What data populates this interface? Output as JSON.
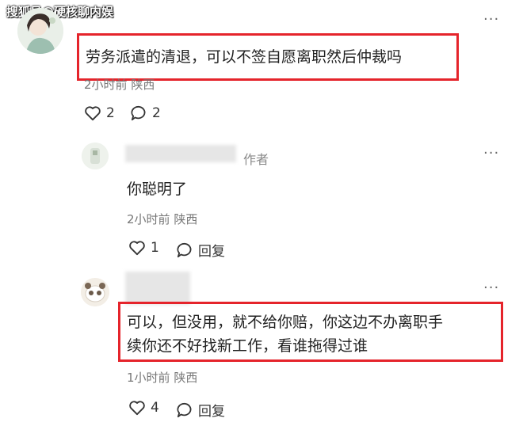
{
  "watermark": "搜狐号@硬核聊内娱",
  "more_label": "···",
  "top_comment": {
    "text": "劳务派遣的清退，可以不签自愿离职然后仲裁吗",
    "time": "2小时前",
    "location": "陕西",
    "like_count": "2",
    "reply_count": "2"
  },
  "reply1": {
    "author_tag": "作者",
    "text": "你聪明了",
    "time": "2小时前",
    "location": "陕西",
    "like_count": "1",
    "reply_label": "回复"
  },
  "reply2": {
    "text_line1": "可以，但没用，就不给你赔，你这边不办离职手",
    "text_line2": "续你还不好找新工作，看谁拖得过谁",
    "time": "1小时前",
    "location": "陕西",
    "like_count": "4",
    "reply_label": "回复"
  },
  "colors": {
    "highlight": "#e5242b",
    "meta": "#777777"
  }
}
